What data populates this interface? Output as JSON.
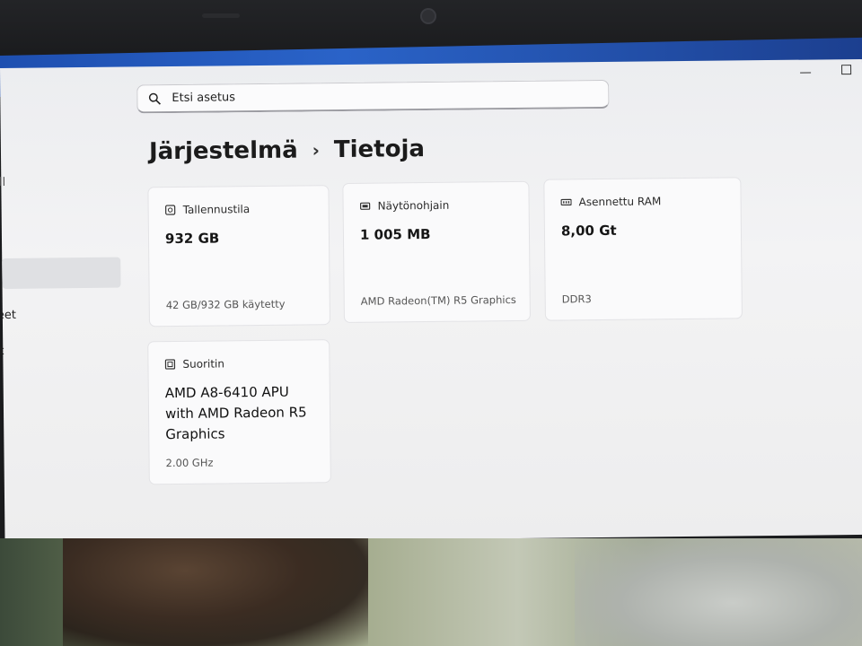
{
  "window": {
    "controls": {
      "minimize": "–",
      "maximize": ""
    }
  },
  "sidebar": {
    "items": [
      {
        "label": "ill"
      },
      {
        "label": "eet"
      },
      {
        "label": "t"
      }
    ]
  },
  "search": {
    "placeholder": "Etsi asetus",
    "icon": "search-icon"
  },
  "breadcrumb": {
    "parent": "Järjestelmä",
    "separator": "›",
    "current": "Tietoja"
  },
  "cards": {
    "storage": {
      "title": "Tallennustila",
      "icon": "storage-icon",
      "value": "932 GB",
      "sub": "42 GB/932 GB käytetty"
    },
    "gpu": {
      "title": "Näytönohjain",
      "icon": "display-adapter-icon",
      "value": "1 005 MB",
      "sub": "AMD Radeon(TM) R5 Graphics"
    },
    "ram": {
      "title": "Asennettu RAM",
      "icon": "memory-icon",
      "value": "8,00 Gt",
      "sub": "DDR3"
    },
    "cpu": {
      "title": "Suoritin",
      "icon": "processor-icon",
      "value_line1": "AMD A8-6410 APU",
      "value_line2": "with AMD Radeon R5",
      "value_line3": "Graphics",
      "sub": "2.00 GHz"
    }
  },
  "colors": {
    "accent_blue": "#2a63c8",
    "window_bg": "#f3f3f4",
    "card_bg": "#fafafb"
  }
}
